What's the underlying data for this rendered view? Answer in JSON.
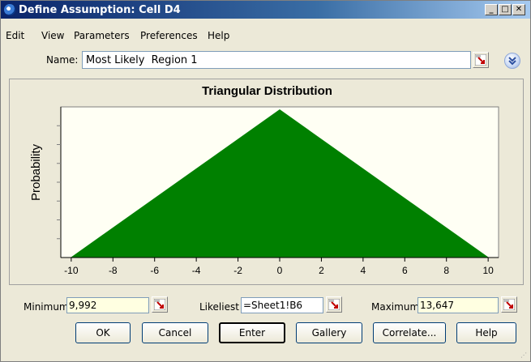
{
  "window": {
    "title": "Define Assumption: Cell D4"
  },
  "menu": [
    {
      "label": "Edit"
    },
    {
      "label": "View"
    },
    {
      "label": "Parameters"
    },
    {
      "label": "Preferences"
    },
    {
      "label": "Help"
    }
  ],
  "name_field": {
    "label": "Name:",
    "value": "Most Likely  Region 1"
  },
  "chart_data": {
    "type": "area",
    "title": "Triangular Distribution",
    "ylabel": "Probability",
    "xlabel": "",
    "x": [
      -10,
      0,
      10
    ],
    "y": [
      0,
      1,
      0
    ],
    "xlim": [
      -10.5,
      10.5
    ],
    "ylim": [
      0,
      1.02
    ],
    "xticks": [
      -10,
      -8,
      -6,
      -4,
      -2,
      0,
      2,
      4,
      6,
      8,
      10
    ],
    "color": "#008000",
    "plot_background": "#fffff4",
    "grid": false
  },
  "params": {
    "minimum": {
      "label": "Minimum",
      "value": "9,992"
    },
    "likeliest": {
      "label": "Likeliest",
      "value": "=Sheet1!B6"
    },
    "maximum": {
      "label": "Maximum",
      "value": "13,647"
    }
  },
  "buttons": {
    "ok": "OK",
    "cancel": "Cancel",
    "enter": "Enter",
    "gallery": "Gallery",
    "correlate": "Correlate...",
    "help": "Help"
  }
}
